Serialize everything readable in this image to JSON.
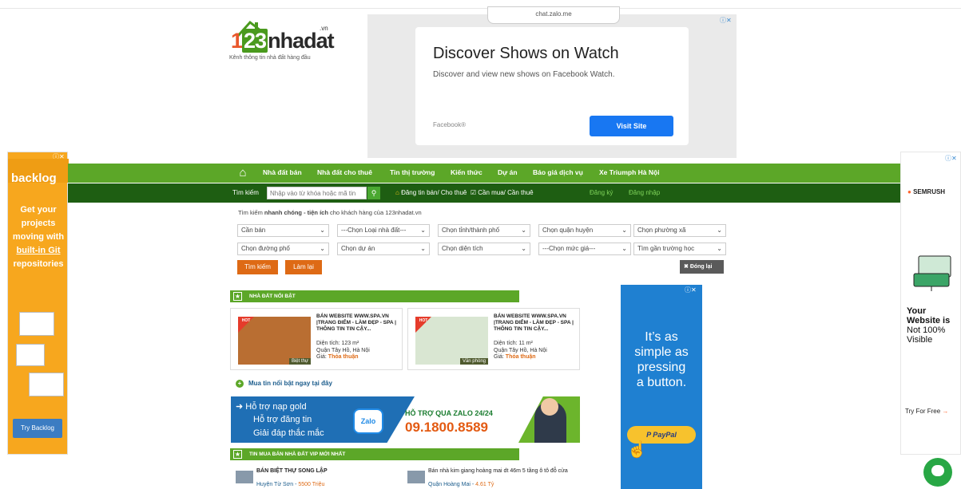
{
  "topad": {
    "pill": "chat.zalo.me",
    "title": "Discover Shows on Watch",
    "desc": "Discover and view new shows on Facebook Watch.",
    "source": "Facebook®",
    "button": "Visit Site"
  },
  "logo": {
    "main": "123nhadat",
    "tld": ".vn",
    "slogan": "Kênh thông tin nhà đất hàng đầu"
  },
  "leftad": {
    "brand": "backlog",
    "l1": "Get your",
    "l2": "projects",
    "l3": "moving with",
    "l4": "built-in Git",
    "l5": "repositories",
    "button": "Try Backlog"
  },
  "rightad": {
    "brand": "SEMRUSH",
    "l1": "Your",
    "l2": "Website is",
    "l3": "Not 100%",
    "l4": "Visible",
    "try": "Try For Free"
  },
  "nav": {
    "items": [
      "Nhà đất bán",
      "Nhà đất cho thuê",
      "Tin thị trường",
      "Kiến thức",
      "Dự án",
      "Báo giá dịch vụ",
      "Xe Triumph Hà Nội"
    ],
    "search_label": "Tìm kiếm",
    "search_placeholder": "Nhập vào từ khóa hoặc mã tin",
    "post1": "Đăng tin bán/ Cho thuê",
    "post2": "Cần mua/ Cần thuê",
    "register": "Đăng ký",
    "login": "Đăng nhập"
  },
  "filter": {
    "desc_a": "Tìm kiếm ",
    "desc_b": "nhanh chóng - tiện ích",
    "desc_c": " cho khách hàng của 123nhadat.vn",
    "row1": [
      "Cần bán",
      "---Chọn Loại nhà đất---",
      "Chọn tỉnh/thành phố",
      "Chọn quận huyện",
      "Chọn phường xã"
    ],
    "row2": [
      "Chọn đường phố",
      "Chọn dự án",
      "Chọn diện tích",
      "---Chọn mức giá---",
      "Tìm gần trường học"
    ],
    "search_btn": "Tìm kiếm",
    "reset_btn": "Làm lại",
    "close_btn": "Đóng lại"
  },
  "featured": {
    "header": "NHÀ ĐẤT NỔI BẬT",
    "cards": [
      {
        "title": "BÁN WEBSITE WWW.SPA.VN |TRANG ĐIỂM - LÀM ĐẸP - SPA | THÔNG TIN TIN CẬY...",
        "area": "Diện tích: 123 m²",
        "loc": "Quận Tây Hồ, Hà Nội",
        "price_label": "Giá:",
        "price": "Thỏa thuận",
        "tag": "Biệt thự",
        "ribbon": "HOT"
      },
      {
        "title": "BÁN WEBSITE WWW.SPA.VN |TRANG ĐIỂM - LÀM ĐẸP - SPA | THÔNG TIN TIN CẬY...",
        "area": "Diện tích: 11 m²",
        "loc": "Quận Tây Hồ, Hà Nội",
        "price_label": "Giá:",
        "price": "Thỏa thuận",
        "tag": "Văn phòng",
        "ribbon": "HOT"
      }
    ],
    "buy_link": "Mua tin nổi bật ngay tại đây"
  },
  "support": {
    "l1": "Hỗ trợ nạp gold",
    "l2": "Hỗ trợ đăng tin",
    "l3": "Giải đáp thắc mắc",
    "zalo": "Zalo",
    "hotline_label": "HỖ TRỢ QUA ZALO 24/24",
    "hotline": "09.1800.8589"
  },
  "latest": {
    "header": "TIN MUA BÁN NHÀ ĐẤT VIP MỚI NHẤT",
    "items": [
      {
        "title": "BÁN BIỆT THỰ SONG LẬP",
        "sub": "Huyện Từ Sơn",
        "price": "5500 Triệu"
      },
      {
        "title": "Bán nhà kim giang hoàng mai dt 46m 5 tầng ô tô đỗ cửa",
        "sub": "Quận Hoàng Mai",
        "price": "4.61 Tỷ"
      }
    ]
  },
  "ppad": {
    "l1": "It’s as",
    "l2": "simple as",
    "l3": "pressing",
    "l4": "a button.",
    "button": "P PayPal"
  }
}
